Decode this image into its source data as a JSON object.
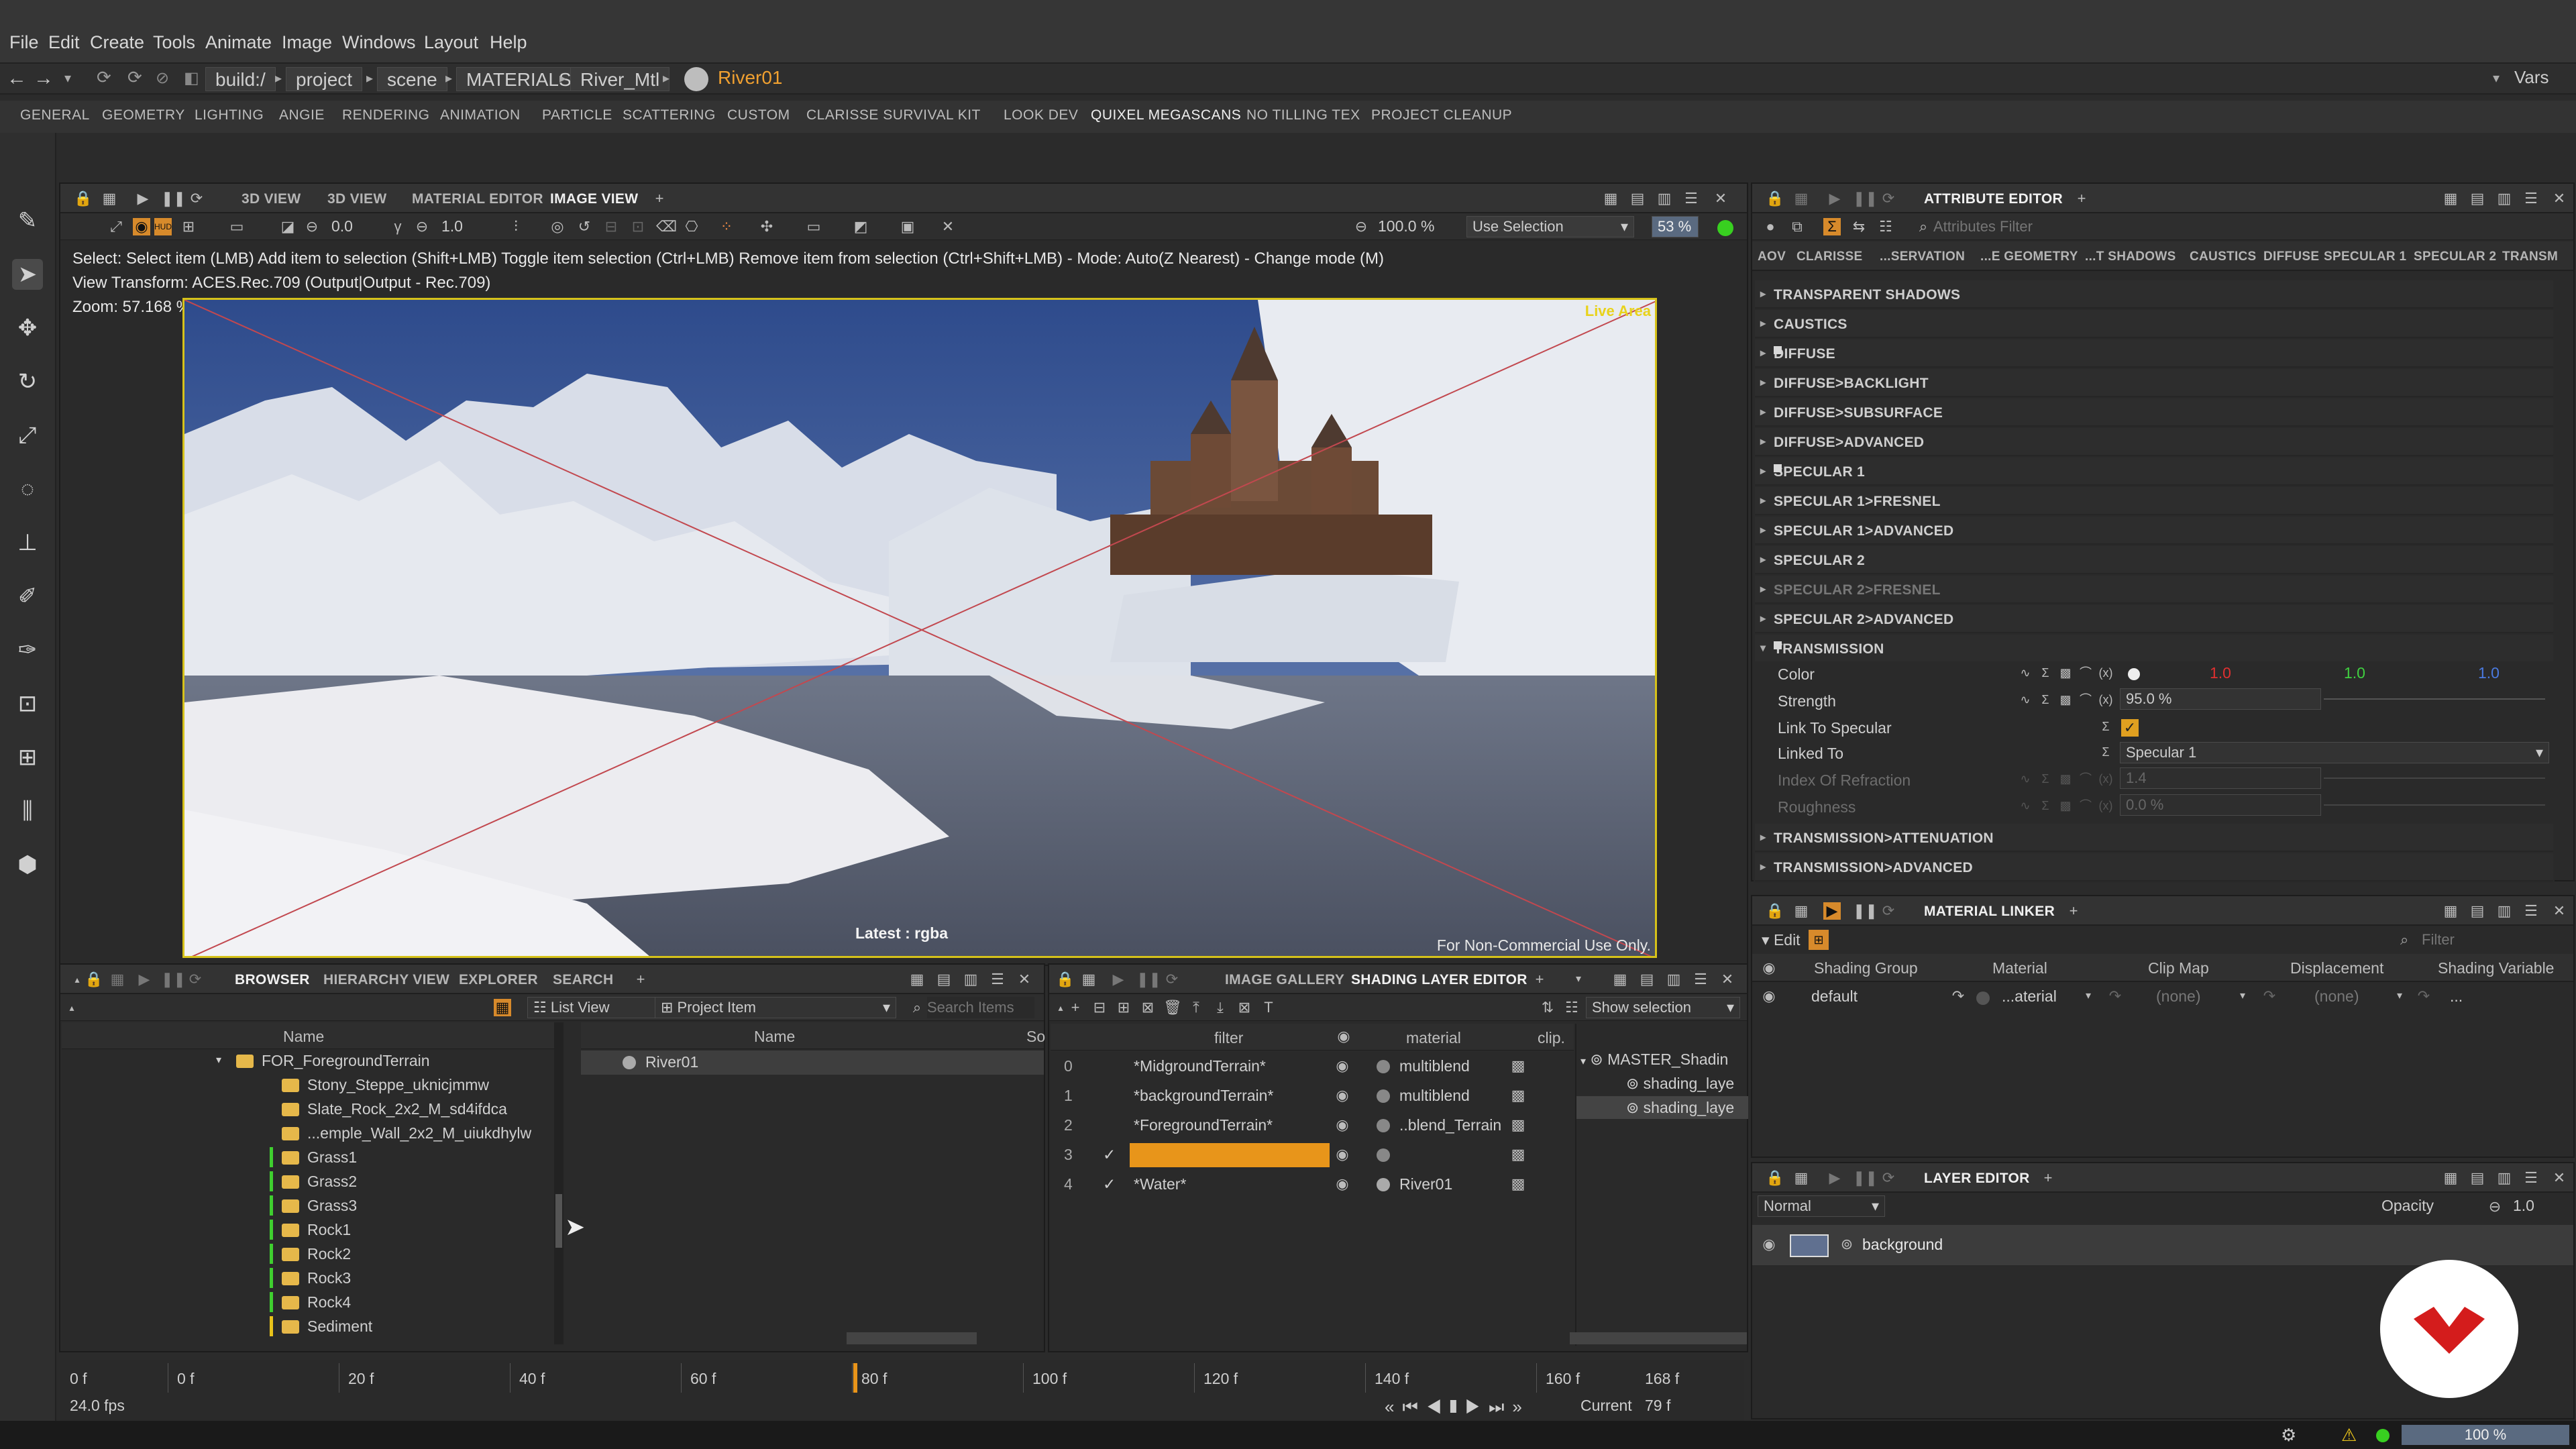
{
  "menu": [
    "File",
    "Edit",
    "Create",
    "Tools",
    "Animate",
    "Image",
    "Windows",
    "Layout",
    "Help"
  ],
  "path": {
    "crumbs": [
      "build:/",
      "project",
      "scene",
      "MATERIALS",
      "River_Mtl"
    ],
    "current": "River01",
    "vars_label": "Vars"
  },
  "shelf_tabs": [
    "GENERAL",
    "GEOMETRY",
    "LIGHTING",
    "ANGIE",
    "RENDERING",
    "ANIMATION",
    "PARTICLE",
    "SCATTERING",
    "CUSTOM",
    "CLARISSE SURVIVAL KIT",
    "LOOK DEV",
    "QUIXEL MEGASCANS",
    "NO TILLING TEX",
    "PROJECT CLEANUP"
  ],
  "viewer": {
    "tabs": [
      "3D VIEW",
      "3D VIEW",
      "MATERIAL EDITOR",
      "IMAGE VIEW"
    ],
    "exposure": "0.0",
    "gamma": "1.0",
    "zoom_field": "100.0 %",
    "selection_mode": "Use Selection",
    "percent": "53",
    "status_line": "Select: Select item (LMB)  Add item to selection (Shift+LMB)  Toggle item selection (Ctrl+LMB)  Remove item from selection (Ctrl+Shift+LMB)  - Mode: Auto(Z Nearest) - Change mode (M)",
    "view_transform": "View Transform: ACES.Rec.709 (Output|Output - Rec.709)",
    "zoom": "Zoom: 57.168 %",
    "live_area": "Live Area",
    "latest": "Latest : rgba",
    "watermark": "For Non-Commercial Use Only."
  },
  "attribute_editor": {
    "title": "ATTRIBUTE EDITOR",
    "filter_placeholder": "Attributes Filter",
    "sub_tabs": [
      "AOV",
      "CLARISSE",
      "...SERVATION",
      "...E GEOMETRY",
      "...T SHADOWS",
      "CAUSTICS",
      "DIFFUSE",
      "SPECULAR 1",
      "SPECULAR 2",
      "TRANSM"
    ],
    "sections": [
      "TRANSPARENT SHADOWS",
      "CAUSTICS",
      "DIFFUSE",
      "DIFFUSE>BACKLIGHT",
      "DIFFUSE>SUBSURFACE",
      "DIFFUSE>ADVANCED",
      "SPECULAR 1",
      "SPECULAR 1>FRESNEL",
      "SPECULAR 1>ADVANCED",
      "SPECULAR 2",
      "SPECULAR 2>FRESNEL",
      "SPECULAR 2>ADVANCED",
      "TRANSMISSION"
    ],
    "sections_after": [
      "TRANSMISSION>ATTENUATION",
      "TRANSMISSION>ADVANCED"
    ],
    "props": {
      "color_label": "Color",
      "color_r": "1.0",
      "color_g": "1.0",
      "color_b": "1.0",
      "strength_label": "Strength",
      "strength_value": "95.0 %",
      "link_label": "Link To Specular",
      "linked_label": "Linked To",
      "linked_value": "Specular 1",
      "ior_label": "Index Of Refraction",
      "ior_value": "1.4",
      "rough_label": "Roughness",
      "rough_value": "0.0 %"
    }
  },
  "material_linker": {
    "title": "MATERIAL LINKER",
    "edit_label": "Edit",
    "filter_placeholder": "Filter",
    "columns": [
      "Shading Group",
      "Material",
      "Clip Map",
      "Displacement",
      "Shading Variable"
    ],
    "row": {
      "group": "default",
      "material": "...aterial",
      "clip": "(none)",
      "disp": "(none)",
      "var": "..."
    }
  },
  "layer_editor": {
    "title": "LAYER EDITOR",
    "blend": "Normal",
    "opacity_label": "Opacity",
    "opacity_value": "1.0",
    "layer": "background"
  },
  "browser": {
    "tabs": [
      "BROWSER",
      "HIERARCHY VIEW",
      "EXPLORER",
      "SEARCH"
    ],
    "list_view": "List View",
    "project_item": "Project Item",
    "search_placeholder": "Search Items",
    "col_name": "Name",
    "col_name2": "Name",
    "col_so": "So",
    "tree": [
      {
        "label": "FOR_ForegroundTerrain",
        "level": 0,
        "marker": ""
      },
      {
        "label": "Stony_Steppe_uknicjmmw",
        "level": 1,
        "marker": ""
      },
      {
        "label": "Slate_Rock_2x2_M_sd4ifdca",
        "level": 1,
        "marker": ""
      },
      {
        "label": "...emple_Wall_2x2_M_uiukdhylw",
        "level": 1,
        "marker": ""
      },
      {
        "label": "Grass1",
        "level": 1,
        "marker": "#3fcf2f"
      },
      {
        "label": "Grass2",
        "level": 1,
        "marker": "#3fcf2f"
      },
      {
        "label": "Grass3",
        "level": 1,
        "marker": "#3fcf2f"
      },
      {
        "label": "Rock1",
        "level": 1,
        "marker": "#3fcf2f"
      },
      {
        "label": "Rock2",
        "level": 1,
        "marker": "#3fcf2f"
      },
      {
        "label": "Rock3",
        "level": 1,
        "marker": "#3fcf2f"
      },
      {
        "label": "Rock4",
        "level": 1,
        "marker": "#3fcf2f"
      },
      {
        "label": "Sediment",
        "level": 1,
        "marker": "#e8c21a"
      }
    ],
    "selected_item": "River01"
  },
  "shading_layer": {
    "tabs": [
      "IMAGE GALLERY",
      "SHADING LAYER EDITOR"
    ],
    "show_selection": "Show selection",
    "columns": [
      "filter",
      "material",
      "clip."
    ],
    "rows": [
      {
        "idx": "0",
        "filter": "*MidgroundTerrain*",
        "material": "multiblend",
        "check": false
      },
      {
        "idx": "1",
        "filter": "*backgroundTerrain*",
        "material": "multiblend",
        "check": false
      },
      {
        "idx": "2",
        "filter": "*ForegroundTerrain*",
        "material": "..blend_Terrain",
        "check": false
      },
      {
        "idx": "3",
        "filter": "",
        "material": "",
        "check": true
      },
      {
        "idx": "4",
        "filter": "*Water*",
        "material": "River01",
        "check": true
      }
    ],
    "tree": [
      "MASTER_Shadin",
      "shading_laye",
      "shading_laye"
    ]
  },
  "timeline": {
    "start": "0 f",
    "fps": "24.0 fps",
    "ticks": [
      "0 f",
      "20 f",
      "40 f",
      "60 f",
      "80 f",
      "100 f",
      "120 f",
      "140 f",
      "160 f"
    ],
    "end": "168 f",
    "current_label": "Current",
    "current_value": "79 f"
  },
  "statusbar": {
    "zoom": "100 %"
  }
}
